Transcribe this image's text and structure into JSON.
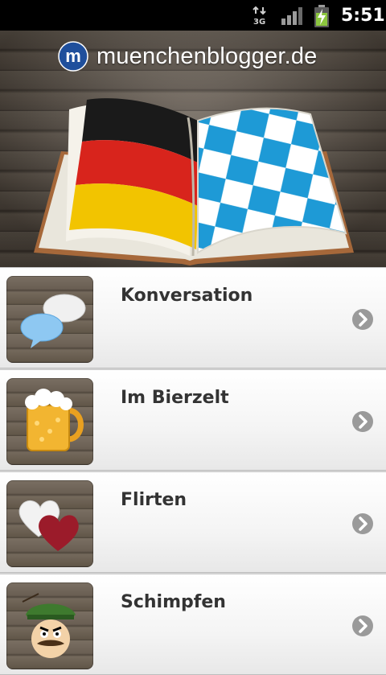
{
  "status_bar": {
    "network_label": "3G",
    "time": "5:51",
    "icons": [
      "data-3g-icon",
      "signal-strength-icon",
      "battery-charging-icon"
    ]
  },
  "header": {
    "brand": "muenchenblogger.de",
    "logo_letter": "m"
  },
  "menu": {
    "items": [
      {
        "label": "Konversation",
        "icon": "speech-bubbles-icon"
      },
      {
        "label": "Im Bierzelt",
        "icon": "beer-mug-icon"
      },
      {
        "label": "Flirten",
        "icon": "hearts-icon"
      },
      {
        "label": "Schimpfen",
        "icon": "bavarian-man-icon"
      }
    ]
  },
  "colors": {
    "flag_black": "#1a1a1a",
    "flag_red": "#d8241c",
    "flag_gold": "#f2c400",
    "bavaria_blue": "#1e9ad6",
    "label_text": "#333333",
    "chevron": "#9a9a9a"
  }
}
